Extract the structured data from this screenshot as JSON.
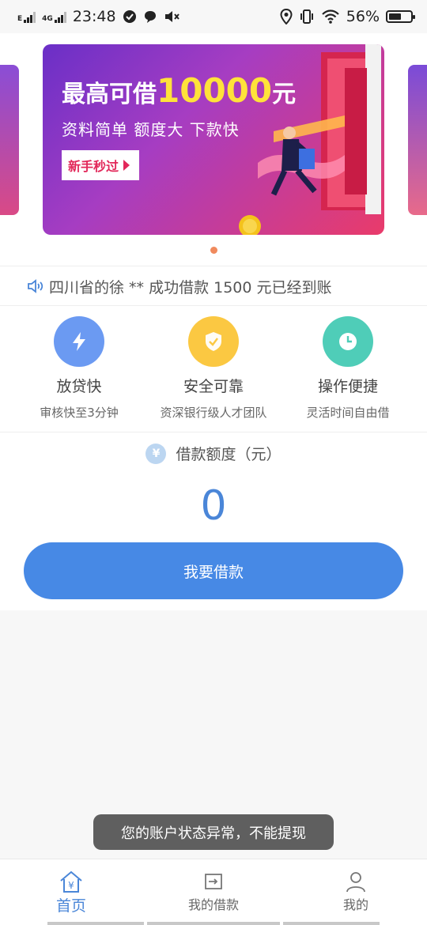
{
  "status_bar": {
    "network_type": "E",
    "network_4g": "4G",
    "time": "23:48",
    "battery_percent": "56%",
    "battery_level": 0.56
  },
  "banner": {
    "title_prefix": "最高可借",
    "title_amount": "10000",
    "title_suffix": "元",
    "subtitle": "资料简单 额度大 下款快",
    "button_label": "新手秒过",
    "page_index": 1,
    "page_count": 1
  },
  "notice": {
    "icon": "speaker-icon",
    "text": "四川省的徐 ** 成功借款 1500 元已经到账"
  },
  "features": [
    {
      "icon": "lightning-icon",
      "color": "#6b9af2",
      "title": "放贷快",
      "subtitle": "审核快至3分钟"
    },
    {
      "icon": "shield-check-icon",
      "color": "#fbc842",
      "title": "安全可靠",
      "subtitle": "资深银行级人才团队"
    },
    {
      "icon": "clock-icon",
      "color": "#4fcdb8",
      "title": "操作便捷",
      "subtitle": "灵活时间自由借"
    }
  ],
  "loan": {
    "label": "借款额度（元）",
    "currency_symbol": "¥",
    "amount": "0",
    "button_label": "我要借款"
  },
  "toast": {
    "message": "您的账户状态异常，不能提现"
  },
  "bottom_nav": {
    "items": [
      {
        "label": "首页",
        "icon": "home-icon",
        "active": true
      },
      {
        "label": "我的借款",
        "icon": "loan-record-icon",
        "active": false
      },
      {
        "label": "我的",
        "icon": "user-icon",
        "active": false
      }
    ]
  },
  "colors": {
    "accent": "#4789e5",
    "amount_text": "#4a86d8",
    "dot_active": "#f08a5d"
  }
}
